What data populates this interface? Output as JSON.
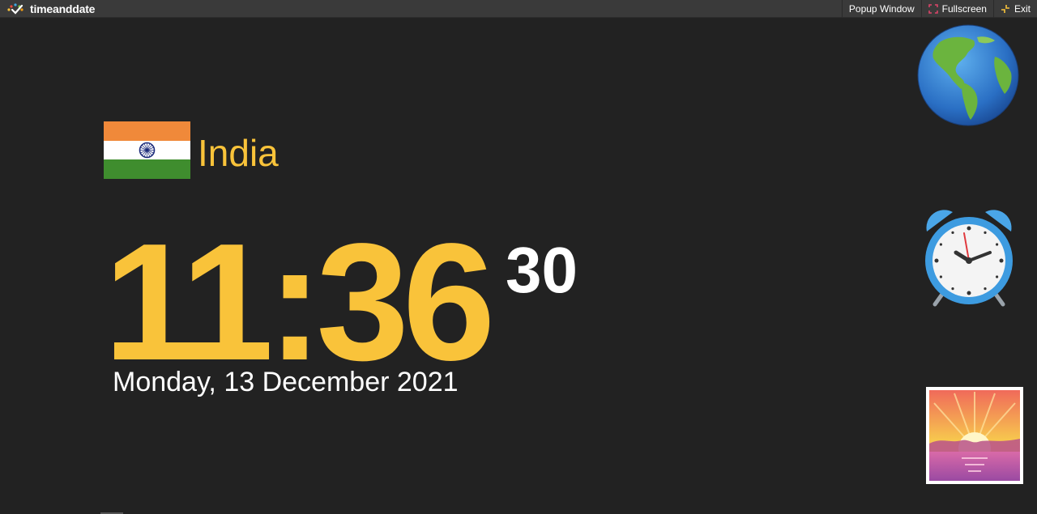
{
  "brand": {
    "logo_text": "timeanddate"
  },
  "toolbar": {
    "popup_label": "Popup Window",
    "fullscreen_label": "Fullscreen",
    "exit_label": "Exit"
  },
  "location": {
    "country": "India",
    "flag_icon": "india-flag-icon"
  },
  "clock": {
    "hours_minutes": "11:36",
    "seconds": "30",
    "date": "Monday, 13 December 2021"
  },
  "side_icons": [
    "globe-icon",
    "alarm-clock-icon",
    "sunrise-icon"
  ],
  "colors": {
    "background": "#222222",
    "accent": "#f9c33a",
    "topbar": "#3a3a3a"
  }
}
